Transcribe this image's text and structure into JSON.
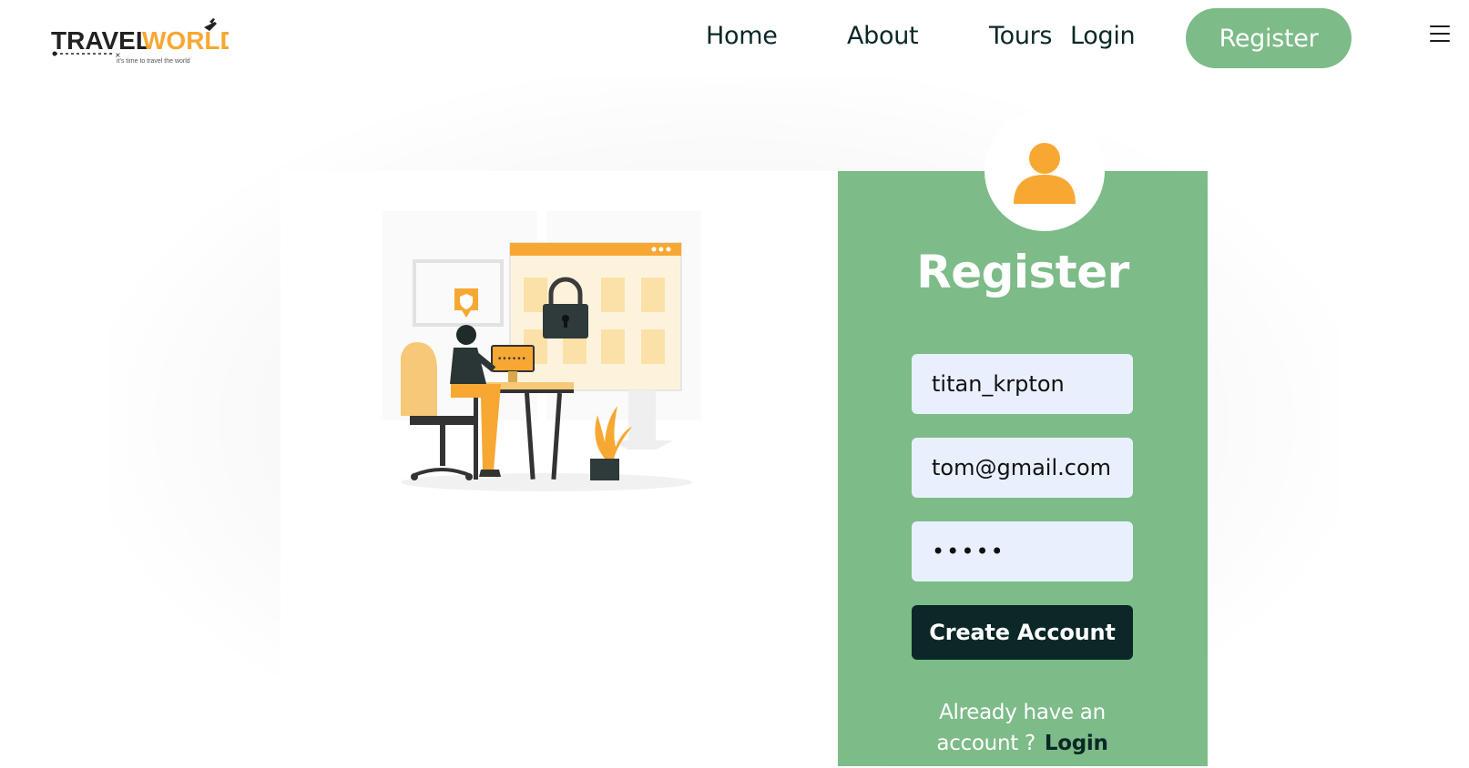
{
  "brand": {
    "name_left": "TRAVEL",
    "name_right": "WORLD",
    "tagline": "it's time to travel the world"
  },
  "nav": {
    "links": [
      "Home",
      "About",
      "Tours",
      "Login"
    ],
    "register_label": "Register",
    "menu_icon": "menu-icon"
  },
  "form": {
    "title": "Register",
    "username_value": "titan_krpton",
    "email_value": "tom@gmail.com",
    "password_value": "•••••",
    "submit_label": "Create Account",
    "footer_text": "Already have an account ?",
    "footer_link": "Login"
  },
  "icons": {
    "avatar": "user-icon",
    "illustration": "secure-login-illustration"
  },
  "colors": {
    "accent_green": "#7dbb88",
    "dark": "#0b2727",
    "orange": "#f7a833",
    "input_bg": "#e8f0fe"
  }
}
